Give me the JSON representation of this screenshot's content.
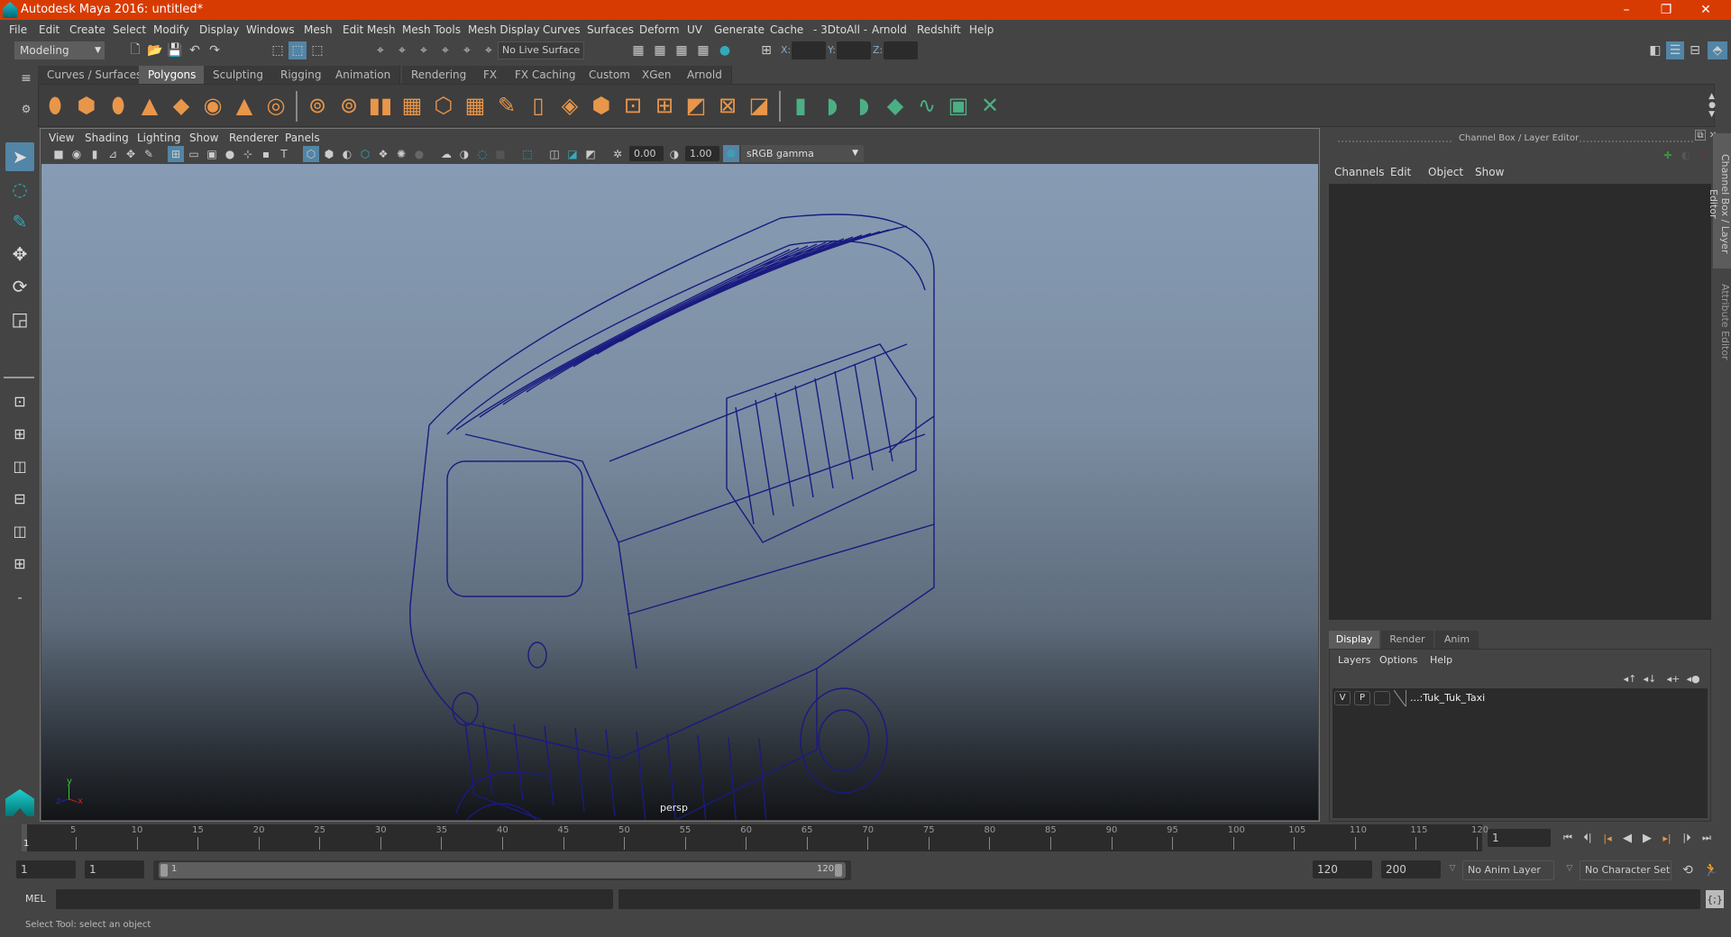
{
  "window": {
    "title": "Autodesk Maya 2016: untitled*",
    "controls": {
      "minimize": "–",
      "restore": "❐",
      "close": "✕"
    }
  },
  "menubar": [
    "File",
    "Edit",
    "Create",
    "Select",
    "Modify",
    "Display",
    "Windows",
    "Mesh",
    "Edit Mesh",
    "Mesh Tools",
    "Mesh Display",
    "Curves",
    "Surfaces",
    "Deform",
    "UV",
    "Generate",
    "Cache",
    "- 3DtoAll -",
    "Arnold",
    "Redshift",
    "Help"
  ],
  "statusline": {
    "mode": "Modeling",
    "live_surface": "No Live Surface",
    "coords": {
      "x_label": "X:",
      "y_label": "Y:",
      "z_label": "Z:",
      "x": "",
      "y": "",
      "z": ""
    }
  },
  "shelf": {
    "tabs": [
      "Curves / Surfaces",
      "Polygons",
      "Sculpting",
      "Rigging",
      "Animation",
      "Rendering",
      "FX",
      "FX Caching",
      "Custom",
      "XGen",
      "Arnold"
    ],
    "active_tab": "Polygons",
    "poly_icons": [
      "poly-sphere",
      "poly-cube",
      "poly-cylinder",
      "poly-cone",
      "poly-plane",
      "poly-torus",
      "poly-pyramid",
      "poly-pipe"
    ],
    "tool_icons": [
      "combine",
      "separate",
      "mirror",
      "smooth",
      "bevel",
      "extrude",
      "multi-cut",
      "bridge",
      "append",
      "fill-hole",
      "target-weld",
      "edge-loop",
      "insert-loop",
      "offset-loop",
      "merge"
    ],
    "uv_icons": [
      "uv-planar",
      "uv-cylindrical",
      "uv-spherical",
      "uv-automatic",
      "uv-unfold",
      "uv-editor",
      "uv-layout"
    ]
  },
  "viewport": {
    "menus": [
      "View",
      "Shading",
      "Lighting",
      "Show",
      "Renderer",
      "Panels"
    ],
    "exposure": "0.00",
    "gamma": "1.00",
    "color_space": "sRGB gamma",
    "camera_label": "persp",
    "axis": {
      "x": "x",
      "y": "y",
      "z": "z"
    },
    "model_color": "#1a1a80"
  },
  "channel_box": {
    "title": "Channel Box / Layer Editor",
    "menus": [
      "Channels",
      "Edit",
      "Object",
      "Show"
    ]
  },
  "layer_editor": {
    "tabs": [
      "Display",
      "Render",
      "Anim"
    ],
    "active_tab": "Display",
    "menus": [
      "Layers",
      "Options",
      "Help"
    ],
    "layers": [
      {
        "v": "V",
        "p": "P",
        "name": "...:Tuk_Tuk_Taxi"
      }
    ]
  },
  "side_tabs": [
    "Channel Box / Layer Editor",
    "Attribute Editor"
  ],
  "timeline": {
    "start_label": "1",
    "ticks": [
      5,
      10,
      15,
      20,
      25,
      30,
      35,
      40,
      45,
      50,
      55,
      60,
      65,
      70,
      75,
      80,
      85,
      90,
      95,
      100,
      105,
      110,
      115,
      120
    ],
    "min": 1,
    "max": 120,
    "current_frame": "1"
  },
  "range": {
    "start": "1",
    "anim_start": "1",
    "slider_start": "1",
    "slider_end": "120",
    "end": "120",
    "anim_end": "200",
    "anim_layer": "No Anim Layer",
    "character_set": "No Character Set"
  },
  "command": {
    "lang": "MEL",
    "input": "",
    "output": ""
  },
  "help_line": "Select Tool: select an object",
  "colors": {
    "title_bar": "#d83b01",
    "accent": "#5285a6",
    "shelf_orange": "#e8964a",
    "shelf_green": "#4caf84"
  }
}
